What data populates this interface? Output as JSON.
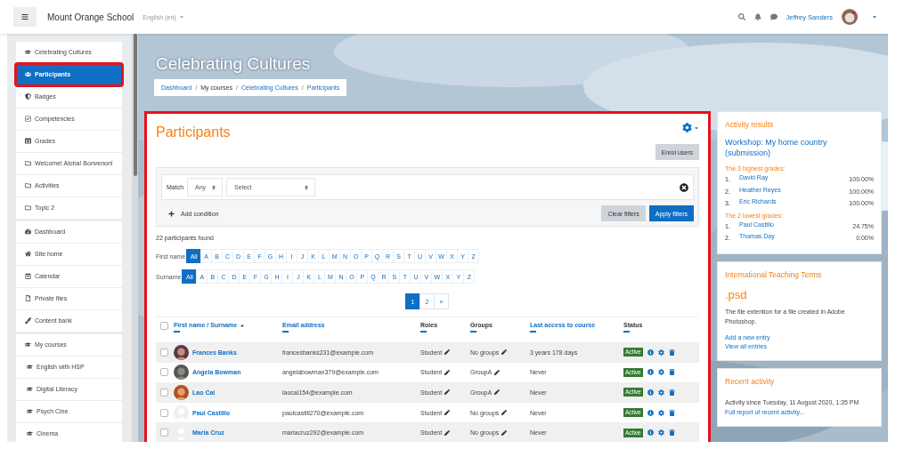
{
  "navbar": {
    "site_name": "Mount Orange School",
    "language": "English (en)",
    "user_name": "Jeffrey Sanders"
  },
  "sidebar": {
    "groups": [
      [
        {
          "label": "Celebrating Cultures",
          "selected": false,
          "highlighted": false
        },
        {
          "label": "Participants",
          "selected": true,
          "highlighted": true
        },
        {
          "label": "Badges",
          "selected": false,
          "highlighted": false
        },
        {
          "label": "Competencies",
          "selected": false,
          "highlighted": false
        },
        {
          "label": "Grades",
          "selected": false,
          "highlighted": false
        },
        {
          "label": "Welcome! Aloha! Bonvenon!",
          "selected": false,
          "highlighted": false
        },
        {
          "label": "Activities",
          "selected": false,
          "highlighted": false
        },
        {
          "label": "Topic 2",
          "selected": false,
          "highlighted": false
        }
      ],
      [
        {
          "label": "Dashboard",
          "selected": false,
          "highlighted": false
        },
        {
          "label": "Site home",
          "selected": false,
          "highlighted": false
        },
        {
          "label": "Calendar",
          "selected": false,
          "highlighted": false
        },
        {
          "label": "Private files",
          "selected": false,
          "highlighted": false
        },
        {
          "label": "Content bank",
          "selected": false,
          "highlighted": false
        }
      ],
      [
        {
          "label": "My courses",
          "selected": false,
          "highlighted": false,
          "children": [
            {
              "label": "English with HSP",
              "selected": false,
              "highlighted": false
            },
            {
              "label": "Digital Literacy",
              "selected": false,
              "highlighted": false
            },
            {
              "label": "Psych Cine",
              "selected": false,
              "highlighted": false
            },
            {
              "label": "Cinema",
              "selected": false,
              "highlighted": false
            }
          ]
        }
      ]
    ]
  },
  "course_title": "Celebrating Cultures",
  "breadcrumb": [
    {
      "label": "Dashboard",
      "kind": "link"
    },
    {
      "label": "/",
      "kind": "separator"
    },
    {
      "label": "My courses",
      "kind": "text"
    },
    {
      "label": "/",
      "kind": "separator"
    },
    {
      "label": "Celebrating Cultures",
      "kind": "link"
    },
    {
      "label": "/",
      "kind": "separator"
    },
    {
      "label": "Participants",
      "kind": "link"
    }
  ],
  "main": {
    "highlighted": true,
    "title": "Participants",
    "enrol_button": "Enrol users",
    "filter": {
      "match_label": "Match",
      "match_value": "Any",
      "select_placeholder": "Select",
      "add_condition": "Add condition",
      "clear_button": "Clear filters",
      "apply_button": "Apply filters"
    },
    "count": "22 participants found",
    "initials": [
      {
        "label": "First name",
        "letters": [
          {
            "label": "All",
            "selected": true
          },
          {
            "label": "A",
            "selected": false
          },
          {
            "label": "B",
            "selected": false
          },
          {
            "label": "C",
            "selected": false
          },
          {
            "label": "D",
            "selected": false
          },
          {
            "label": "E",
            "selected": false
          },
          {
            "label": "F",
            "selected": false
          },
          {
            "label": "G",
            "selected": false
          },
          {
            "label": "H",
            "selected": false
          },
          {
            "label": "I",
            "selected": false
          },
          {
            "label": "J",
            "selected": false
          },
          {
            "label": "K",
            "selected": false
          },
          {
            "label": "L",
            "selected": false
          },
          {
            "label": "M",
            "selected": false
          },
          {
            "label": "N",
            "selected": false
          },
          {
            "label": "O",
            "selected": false
          },
          {
            "label": "P",
            "selected": false
          },
          {
            "label": "Q",
            "selected": false
          },
          {
            "label": "R",
            "selected": false
          },
          {
            "label": "S",
            "selected": false
          },
          {
            "label": "T",
            "selected": false
          },
          {
            "label": "U",
            "selected": false
          },
          {
            "label": "V",
            "selected": false
          },
          {
            "label": "W",
            "selected": false
          },
          {
            "label": "X",
            "selected": false
          },
          {
            "label": "Y",
            "selected": false
          },
          {
            "label": "Z",
            "selected": false
          }
        ]
      },
      {
        "label": "Surname",
        "letters": [
          {
            "label": "All",
            "selected": true
          },
          {
            "label": "A",
            "selected": false
          },
          {
            "label": "B",
            "selected": false
          },
          {
            "label": "C",
            "selected": false
          },
          {
            "label": "D",
            "selected": false
          },
          {
            "label": "E",
            "selected": false
          },
          {
            "label": "F",
            "selected": false
          },
          {
            "label": "G",
            "selected": false
          },
          {
            "label": "H",
            "selected": false
          },
          {
            "label": "I",
            "selected": false
          },
          {
            "label": "J",
            "selected": false
          },
          {
            "label": "K",
            "selected": false
          },
          {
            "label": "L",
            "selected": false
          },
          {
            "label": "M",
            "selected": false
          },
          {
            "label": "N",
            "selected": false
          },
          {
            "label": "O",
            "selected": false
          },
          {
            "label": "P",
            "selected": false
          },
          {
            "label": "Q",
            "selected": false
          },
          {
            "label": "R",
            "selected": false
          },
          {
            "label": "S",
            "selected": false
          },
          {
            "label": "T",
            "selected": false
          },
          {
            "label": "U",
            "selected": false
          },
          {
            "label": "V",
            "selected": false
          },
          {
            "label": "W",
            "selected": false
          },
          {
            "label": "X",
            "selected": false
          },
          {
            "label": "Y",
            "selected": false
          },
          {
            "label": "Z",
            "selected": false
          }
        ]
      }
    ],
    "pagination": [
      {
        "label": "1",
        "selected": true
      },
      {
        "label": "2",
        "selected": false
      },
      {
        "label": "»",
        "selected": false
      }
    ],
    "table": {
      "select_all_checked": false,
      "columns": [
        {
          "label": "First name / Surname",
          "kind": "link",
          "sorted": true
        },
        {
          "label": "Email address",
          "kind": "link",
          "sorted": false
        },
        {
          "label": "Roles",
          "kind": "text",
          "sorted": false
        },
        {
          "label": "Groups",
          "kind": "text",
          "sorted": false
        },
        {
          "label": "Last access to course",
          "kind": "link",
          "sorted": false
        },
        {
          "label": "Status",
          "kind": "text",
          "sorted": false
        }
      ],
      "rows": [
        {
          "checked": false,
          "name": "Frances Banks",
          "email": "francesbanks231@example.com",
          "role": "Student",
          "groups": "No groups",
          "last_access": "3 years 178 days",
          "status": "Active"
        },
        {
          "checked": false,
          "name": "Angela Bowman",
          "email": "angelabowman379@example.com",
          "role": "Student",
          "groups": "GroupA",
          "last_access": "Never",
          "status": "Active"
        },
        {
          "checked": false,
          "name": "Lao Cai",
          "email": "laocai154@example.com",
          "role": "Student",
          "groups": "GroupA",
          "last_access": "Never",
          "status": "Active"
        },
        {
          "checked": false,
          "avatar": {
            "kind": "default"
          },
          "name": "Paul Castillo",
          "email": "paulcastill270@example.com",
          "role": "Student",
          "groups": "No groups",
          "last_access": "Never",
          "status": "Active"
        },
        {
          "checked": false,
          "avatar": {
            "kind": "default"
          },
          "name": "Maria Cruz",
          "email": "mariacruz292@example.com",
          "role": "Student",
          "groups": "No groups",
          "last_access": "Never",
          "status": "Active"
        }
      ]
    }
  },
  "blocks": [
    {
      "kind": "activity_results",
      "title": "Activity results",
      "link_title": "Workshop: My home country (submission)",
      "highest_label": "The 3 highest grades:",
      "highest": [
        {
          "rank": "1.",
          "name": "David Ray",
          "grade": "100.00%"
        },
        {
          "rank": "2.",
          "name": "Heather Reyes",
          "grade": "100.00%"
        },
        {
          "rank": "3.",
          "name": "Eric Richards",
          "grade": "100.00%"
        }
      ],
      "lowest_label": "The 2 lowest grades:",
      "lowest": [
        {
          "rank": "1.",
          "name": "Paul Castillo",
          "grade": "24.75%"
        },
        {
          "rank": "2.",
          "name": "Thomas Day",
          "grade": "0.00%"
        }
      ]
    },
    {
      "kind": "glossary",
      "title": "International Teaching Terms",
      "term": ".psd",
      "definition": "The file extention for a file created in Adobe Photoshop.",
      "links": [
        "Add a new entry",
        "View all entries"
      ]
    },
    {
      "kind": "recent",
      "title": "Recent activity",
      "text": "Activity since Tuesday, 11 August 2020, 1:35 PM",
      "link": "Full report of recent activity..."
    }
  ]
}
